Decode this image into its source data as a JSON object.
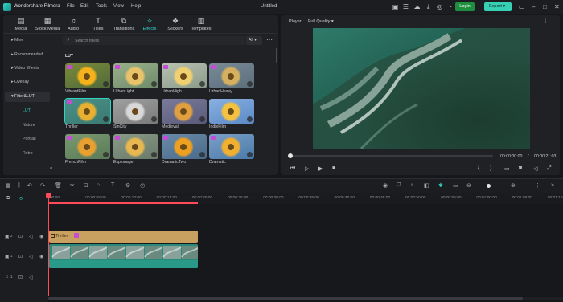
{
  "app": {
    "name": "Wondershare Filmora",
    "menu": [
      "File",
      "Edit",
      "Tools",
      "View",
      "Help"
    ],
    "project_title": "Untitled",
    "login_label": "Login",
    "export_label": "Export",
    "accent_color": "#2fd4c4"
  },
  "tabs": [
    {
      "label": "Media",
      "icon": "media-icon"
    },
    {
      "label": "Stock Media",
      "icon": "stock-media-icon"
    },
    {
      "label": "Audio",
      "icon": "music-note-icon"
    },
    {
      "label": "Titles",
      "icon": "titles-icon"
    },
    {
      "label": "Transitions",
      "icon": "transitions-icon"
    },
    {
      "label": "Effects",
      "icon": "effects-icon",
      "active": true
    },
    {
      "label": "Stickers",
      "icon": "stickers-icon"
    },
    {
      "label": "Templates",
      "icon": "templates-icon"
    }
  ],
  "sidebar": {
    "items": [
      "Mine",
      "Recommended",
      "Video Effects",
      "Overlay",
      "Filter&LUT"
    ],
    "subitems": [
      "LUT",
      "Nature",
      "Portrait",
      "Retro"
    ],
    "selected_item": "Filter&LUT",
    "selected_subitem": "LUT"
  },
  "search": {
    "placeholder": "Search filters",
    "filter_value": "All"
  },
  "lut_section_label": "LUT",
  "thumbnails": [
    {
      "name": "VibrantFilm",
      "style": "vibrant",
      "gem": true
    },
    {
      "name": "UrbanLight",
      "style": "urbanlight",
      "gem": true
    },
    {
      "name": "UrbanHigh",
      "style": "urbanhigh",
      "gem": true
    },
    {
      "name": "UrbanHeavy",
      "style": "urbanheavy",
      "gem": true
    },
    {
      "name": "Thriller",
      "style": "thriller",
      "gem": true,
      "selected": true
    },
    {
      "name": "SinCity",
      "style": "sincity",
      "gem": false
    },
    {
      "name": "Medieval",
      "style": "medieval",
      "gem": false
    },
    {
      "name": "IndieFilm",
      "style": "indie",
      "gem": false
    },
    {
      "name": "FrenchFilm",
      "style": "french",
      "gem": true
    },
    {
      "name": "Espionage",
      "style": "espionage",
      "gem": true
    },
    {
      "name": "DramaticTwo",
      "style": "dramatictwo",
      "gem": true
    },
    {
      "name": "Dramatic",
      "style": "dramatic",
      "gem": true
    }
  ],
  "player": {
    "label": "Player",
    "quality": "Full Quality",
    "current_time": "00:00:00:00",
    "separator": "/",
    "total_time": "00:00:21:03"
  },
  "timeline": {
    "ruler_labels": [
      "00:00",
      "00:00:05:00",
      "00:00:10:00",
      "00:00:15:00",
      "00:00:20:00",
      "00:00:25:00",
      "00:00:30:00",
      "00:00:35:00",
      "00:00:40:00",
      "00:00:45:00",
      "00:00:50:00",
      "00:00:55:00",
      "00:01:00:00",
      "00:01:05:00",
      "00:01:10:00"
    ],
    "tracks": [
      {
        "number": "2",
        "type": "video"
      },
      {
        "number": "1",
        "type": "video"
      },
      {
        "number": "1",
        "type": "audio"
      }
    ],
    "effect_clip_label": "Thriller",
    "effect_clip_color": "#c8a060",
    "video_clip_color": "#2a8a7a",
    "playhead_color": "#ff4a5a"
  }
}
